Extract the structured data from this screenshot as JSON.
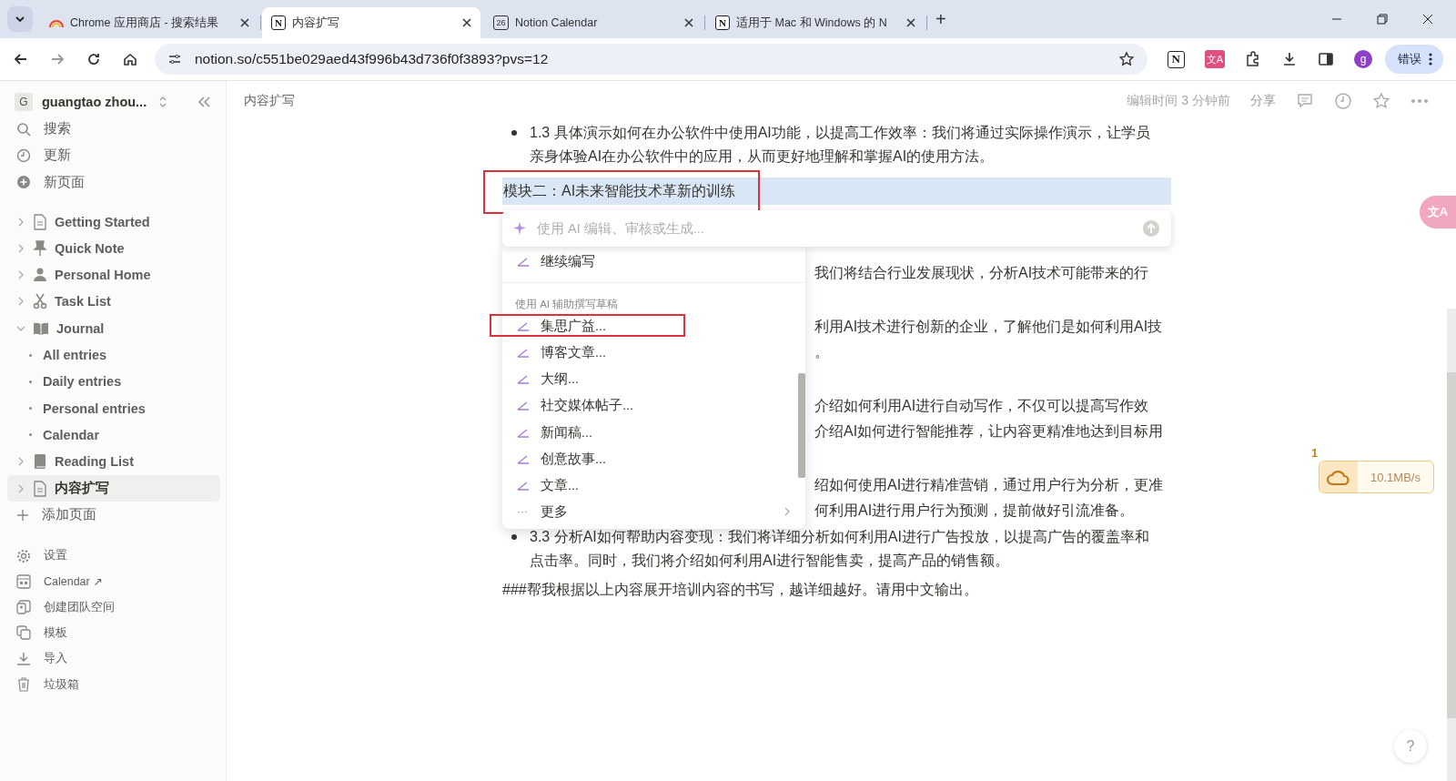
{
  "browser": {
    "tabs": [
      {
        "title": "Chrome 应用商店 - 搜索结果",
        "kind": "rainbow",
        "selected": false
      },
      {
        "title": "内容扩写",
        "kind": "notion",
        "favicon_text": "N",
        "selected": true
      },
      {
        "title": "Notion Calendar",
        "kind": "calendar",
        "favicon_text": "26",
        "selected": false
      },
      {
        "title": "适用于 Mac 和 Windows 的 N",
        "kind": "notion",
        "favicon_text": "N",
        "selected": false
      }
    ],
    "new_tab": "+",
    "url": "notion.so/c551be029aed43f996b43d736f0f3893?pvs=12",
    "notion_extension": "N",
    "translate_extension": "文A",
    "profile": "g",
    "error_button": "错误"
  },
  "sidebar": {
    "workspace": "guangtao zhou...",
    "workspace_initial": "G",
    "actions": [
      {
        "label": "搜索",
        "kind": "search"
      },
      {
        "label": "更新",
        "kind": "clock"
      },
      {
        "label": "新页面",
        "kind": "plus"
      }
    ],
    "pages": [
      {
        "label": "Getting Started",
        "kind": "doc",
        "expanded": false,
        "selected": false
      },
      {
        "label": "Quick Note",
        "kind": "pin",
        "expanded": false,
        "selected": false
      },
      {
        "label": "Personal Home",
        "kind": "person",
        "expanded": false,
        "selected": false
      },
      {
        "label": "Task List",
        "kind": "scissors",
        "expanded": false,
        "selected": false
      },
      {
        "label": "Journal",
        "kind": "book",
        "expanded": true,
        "selected": false,
        "children": [
          {
            "label": "All entries"
          },
          {
            "label": "Daily entries"
          },
          {
            "label": "Personal entries"
          },
          {
            "label": "Calendar"
          }
        ]
      },
      {
        "label": "Reading List",
        "kind": "closedbook",
        "expanded": false,
        "selected": false
      },
      {
        "label": "内容扩写",
        "kind": "doc",
        "expanded": false,
        "selected": true
      }
    ],
    "add_page": "添加页面",
    "footer": [
      {
        "label": "设置",
        "kind": "gear"
      },
      {
        "label": "Calendar ↗",
        "kind": "cal"
      },
      {
        "label": "创建团队空间",
        "kind": "team"
      },
      {
        "label": "模板",
        "kind": "template"
      },
      {
        "label": "导入",
        "kind": "import"
      },
      {
        "label": "垃圾箱",
        "kind": "trash"
      }
    ]
  },
  "topbar": {
    "breadcrumb": "内容扩写",
    "edited": "编辑时间 3 分钟前",
    "share": "分享"
  },
  "document": {
    "blocks": [
      {
        "kind": "bullet",
        "text": "1.3 具体演示如何在办公软件中使用AI功能，以提高工作效率：我们将通过实际操作演示，让学员亲身体验AI在办公软件中的应用，从而更好地理解和掌握AI的使用方法。"
      },
      {
        "kind": "selected",
        "text": "模块二：AI未来智能技术革新的训练"
      },
      {
        "kind": "fragment",
        "text": "我们将结合行业发展现状，分析AI技术可能带来的行"
      },
      {
        "kind": "gap"
      },
      {
        "kind": "fragment",
        "text": "利用AI技术进行创新的企业，了解他们是如何利用AI技"
      },
      {
        "kind": "fragment",
        "text": "。"
      },
      {
        "kind": "gap"
      },
      {
        "kind": "fragment",
        "text": "介绍如何利用AI进行自动写作，不仅可以提高写作效"
      },
      {
        "kind": "fragment",
        "text": "介绍AI如何进行智能推荐，让内容更精准地达到目标用"
      },
      {
        "kind": "gap"
      },
      {
        "kind": "fragment",
        "text": "绍如何使用AI进行精准营销，通过用户行为分析，更准"
      },
      {
        "kind": "fragment",
        "text": "何利用AI进行用户行为预测，提前做好引流准备。"
      },
      {
        "kind": "bullet",
        "text": "3.3 分析AI如何帮助内容变现：我们将详细分析如何利用AI进行广告投放，以提高广告的覆盖率和点击率。同时，我们将介绍如何利用AI进行智能售卖，提高产品的销售额。"
      },
      {
        "kind": "paragraph",
        "text": "###帮我根据以上内容展开培训内容的书写，越详细越好。请用中文输出。"
      }
    ]
  },
  "ai_prompt": {
    "placeholder": "使用 AI 编辑、审核或生成..."
  },
  "ai_menu": {
    "top_item": "继续编写",
    "section": "使用 AI 辅助撰写草稿",
    "items": [
      {
        "label": "集思广益...",
        "selected": true
      },
      {
        "label": "博客文章...",
        "selected": false
      },
      {
        "label": "大纲...",
        "selected": false
      },
      {
        "label": "社交媒体帖子...",
        "selected": false
      },
      {
        "label": "新闻稿...",
        "selected": false
      },
      {
        "label": "创意故事...",
        "selected": false
      },
      {
        "label": "文章...",
        "selected": false
      }
    ],
    "more": "更多",
    "more_glyph": "···"
  },
  "translate_button": "文A",
  "download_widget": {
    "count": "1",
    "speed": "10.1MB/s"
  },
  "help": "?"
}
